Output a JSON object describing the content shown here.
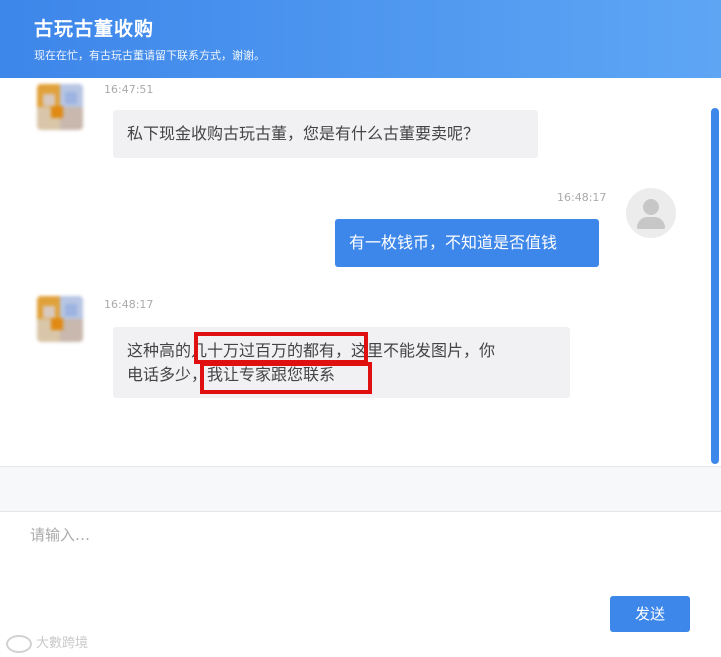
{
  "header": {
    "title": "古玩古董收购",
    "subtitle": "现在在忙，有古玩古董请留下联系方式，谢谢。"
  },
  "messages": [
    {
      "side": "left",
      "time": "16:47:51",
      "text": "私下现金收购古玩古董，您是有什么古董要卖呢？"
    },
    {
      "side": "right",
      "time": "16:48:17",
      "text": "有一枚钱币，不知道是否值钱"
    },
    {
      "side": "left",
      "time": "16:48:17",
      "line1_a": "这种高的",
      "line1_b": "几十万过百万的都有",
      "line1_c": "，这里不能发图片，你",
      "line2_a": "电话多少",
      "line2_b": "，我让专家跟您联系"
    }
  ],
  "input": {
    "placeholder": "请输入…"
  },
  "send_label": "发送",
  "watermark": "大數跨境",
  "colors": {
    "accent": "#3d86ea",
    "highlight": "#e01010"
  }
}
